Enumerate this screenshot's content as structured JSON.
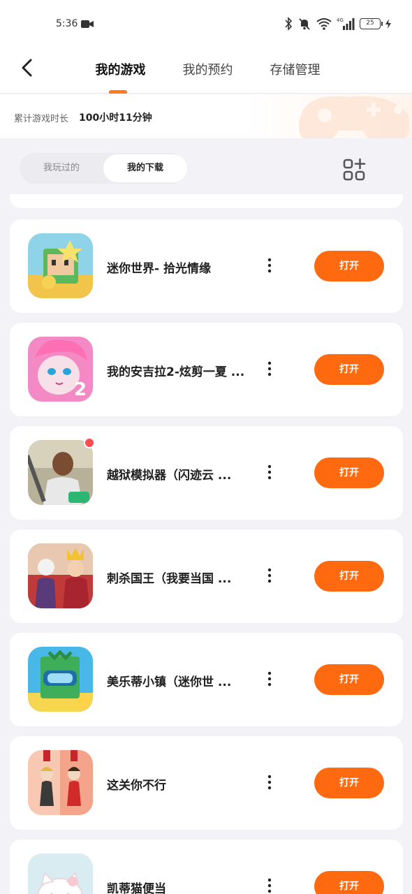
{
  "status": {
    "time": "5:36",
    "battery": "25"
  },
  "header": {
    "tabs": [
      {
        "label": "我的游戏"
      },
      {
        "label": "我的预约"
      },
      {
        "label": "存储管理"
      }
    ]
  },
  "playtime": {
    "label": "累计游戏时长",
    "value": "100小时11分钟"
  },
  "segment": {
    "played": "我玩过的",
    "downloads": "我的下载"
  },
  "games": [
    {
      "name": "迷你世界- 拾光情缘",
      "button": "打开"
    },
    {
      "name": "我的安吉拉2-炫剪一夏 ...",
      "button": "打开"
    },
    {
      "name": "越狱模拟器（闪迹云 ...",
      "button": "打开"
    },
    {
      "name": "刺杀国王（我要当国 ...",
      "button": "打开"
    },
    {
      "name": "美乐蒂小镇（迷你世 ...",
      "button": "打开"
    },
    {
      "name": "这关你不行",
      "button": "打开"
    },
    {
      "name": "凯蒂猫便当",
      "button": "打开"
    }
  ],
  "colors": {
    "accent": "#ff6a10",
    "badge": "#ff4d4f"
  }
}
